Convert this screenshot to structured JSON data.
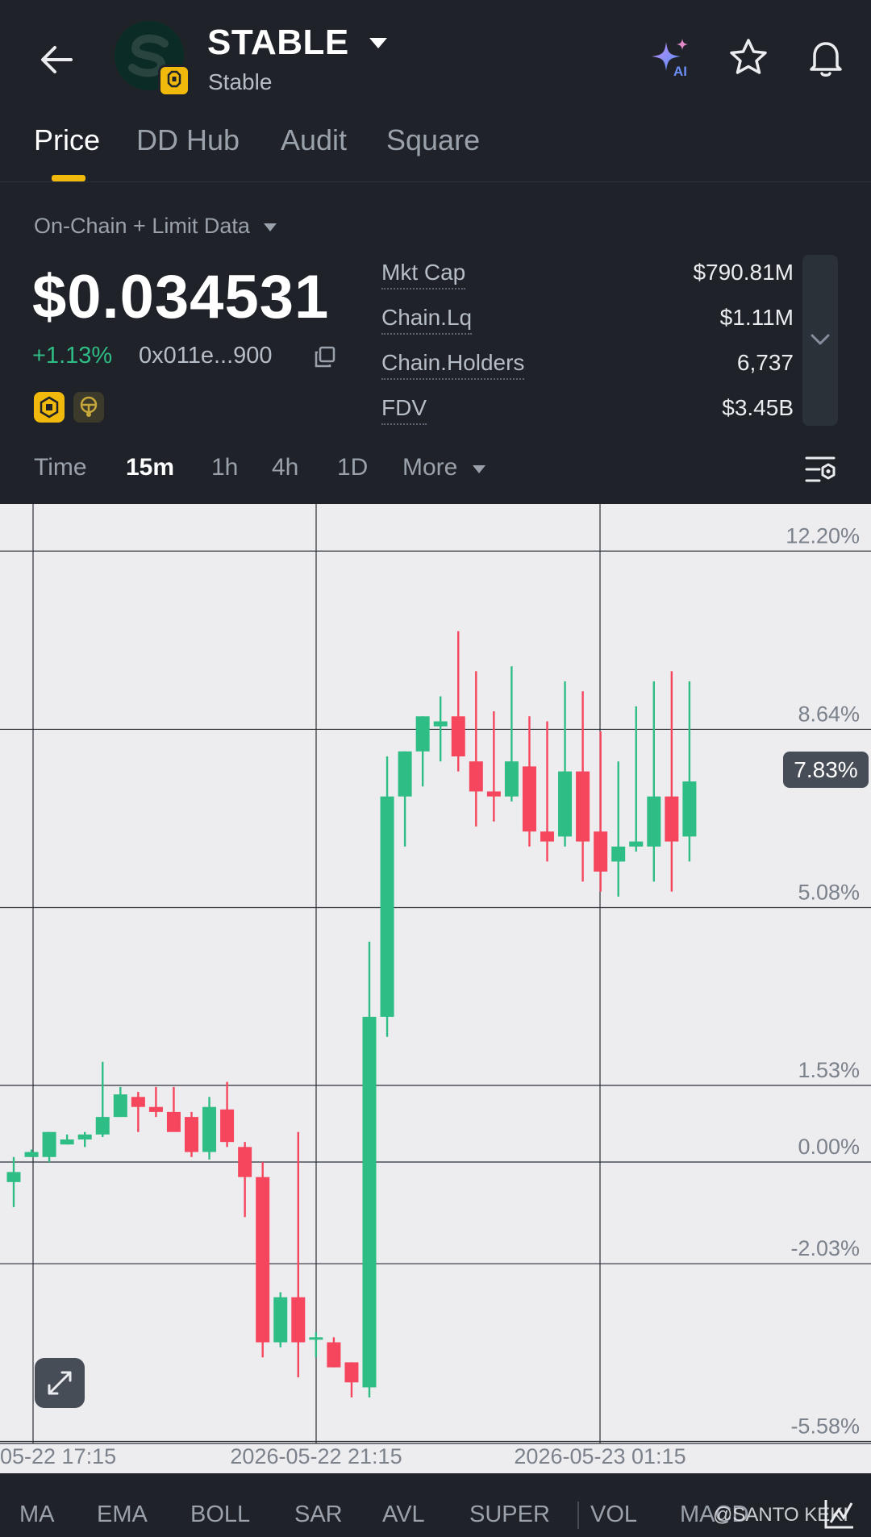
{
  "header": {
    "title": "STABLE",
    "subtitle": "Stable",
    "tabs": [
      {
        "label": "Price",
        "active": true
      },
      {
        "label": "DD Hub",
        "active": false
      },
      {
        "label": "Audit",
        "active": false
      },
      {
        "label": "Square",
        "active": false
      }
    ],
    "icons": [
      "back-arrow-icon",
      "ai-sparkle-icon",
      "star-icon",
      "bell-icon"
    ]
  },
  "info": {
    "data_source": "On-Chain + Limit Data",
    "price": "$0.034531",
    "change": "+1.13%",
    "address": "0x011e...900",
    "stats": [
      {
        "label": "Mkt Cap",
        "value": "$790.81M"
      },
      {
        "label": "Chain.Lq",
        "value": "$1.11M"
      },
      {
        "label": "Chain.Holders",
        "value": "6,737"
      },
      {
        "label": "FDV",
        "value": "$3.45B"
      }
    ]
  },
  "timeframes": [
    {
      "label": "Time",
      "active": false
    },
    {
      "label": "15m",
      "active": true
    },
    {
      "label": "1h",
      "active": false
    },
    {
      "label": "4h",
      "active": false
    },
    {
      "label": "1D",
      "active": false
    },
    {
      "label": "More",
      "active": false
    }
  ],
  "chart_data": {
    "type": "candlestick",
    "y_unit": "%",
    "y_ticks": [
      "12.20%",
      "8.64%",
      "5.08%",
      "1.53%",
      "0.00%",
      "-2.03%",
      "-5.58%"
    ],
    "x_ticks": [
      "05-22 17:15",
      "2026-05-22 21:15",
      "2026-05-23 01:15"
    ],
    "current_value_label": "7.83%",
    "colors": {
      "up": "#2ebd85",
      "down": "#f6465d"
    },
    "candles": [
      {
        "o": -0.4,
        "c": -0.2,
        "h": 0.1,
        "l": -0.9
      },
      {
        "o": 0.1,
        "c": 0.2,
        "h": 0.25,
        "l": 0.1
      },
      {
        "o": 0.1,
        "c": 0.6,
        "h": 0.6,
        "l": 0.0
      },
      {
        "o": 0.35,
        "c": 0.45,
        "h": 0.55,
        "l": 0.35
      },
      {
        "o": 0.45,
        "c": 0.55,
        "h": 0.6,
        "l": 0.3
      },
      {
        "o": 0.55,
        "c": 0.9,
        "h": 2.0,
        "l": 0.5
      },
      {
        "o": 0.9,
        "c": 1.35,
        "h": 1.5,
        "l": 0.9
      },
      {
        "o": 1.3,
        "c": 1.1,
        "h": 1.4,
        "l": 0.6
      },
      {
        "o": 1.1,
        "c": 1.0,
        "h": 1.5,
        "l": 0.9
      },
      {
        "o": 1.0,
        "c": 0.6,
        "h": 1.5,
        "l": 0.7
      },
      {
        "o": 0.9,
        "c": 0.2,
        "h": 1.0,
        "l": 0.1
      },
      {
        "o": 0.2,
        "c": 1.1,
        "h": 1.3,
        "l": 0.05
      },
      {
        "o": 1.05,
        "c": 0.4,
        "h": 1.6,
        "l": 0.3
      },
      {
        "o": 0.3,
        "c": -0.3,
        "h": 0.4,
        "l": -1.1
      },
      {
        "o": -0.3,
        "c": -3.6,
        "h": 0.0,
        "l": -3.9
      },
      {
        "o": -3.6,
        "c": -2.7,
        "h": -2.6,
        "l": -3.7
      },
      {
        "o": -2.7,
        "c": -3.6,
        "h": 0.6,
        "l": -4.3
      },
      {
        "o": -3.5,
        "c": -3.5,
        "h": -3.4,
        "l": -3.9
      },
      {
        "o": -3.6,
        "c": -4.1,
        "h": -3.5,
        "l": -4.1
      },
      {
        "o": -4.0,
        "c": -4.4,
        "h": -4.0,
        "l": -4.7
      },
      {
        "o": -4.5,
        "c": 2.9,
        "h": 4.4,
        "l": -4.7
      },
      {
        "o": 2.9,
        "c": 7.3,
        "h": 8.1,
        "l": 2.5
      },
      {
        "o": 7.3,
        "c": 8.2,
        "h": 8.2,
        "l": 6.3
      },
      {
        "o": 8.2,
        "c": 8.9,
        "h": 8.9,
        "l": 7.5
      },
      {
        "o": 8.7,
        "c": 8.8,
        "h": 9.3,
        "l": 8.0
      },
      {
        "o": 8.9,
        "c": 8.1,
        "h": 10.6,
        "l": 7.8
      },
      {
        "o": 8.0,
        "c": 7.4,
        "h": 9.8,
        "l": 6.7
      },
      {
        "o": 7.4,
        "c": 7.3,
        "h": 9.0,
        "l": 6.8
      },
      {
        "o": 7.3,
        "c": 8.0,
        "h": 9.9,
        "l": 7.2
      },
      {
        "o": 7.9,
        "c": 6.6,
        "h": 8.9,
        "l": 6.3
      },
      {
        "o": 6.6,
        "c": 6.4,
        "h": 8.8,
        "l": 6.0
      },
      {
        "o": 6.5,
        "c": 7.8,
        "h": 9.6,
        "l": 6.3
      },
      {
        "o": 7.8,
        "c": 6.4,
        "h": 9.4,
        "l": 5.6
      },
      {
        "o": 6.6,
        "c": 5.8,
        "h": 8.6,
        "l": 5.4
      },
      {
        "o": 6.0,
        "c": 6.3,
        "h": 8.0,
        "l": 5.3
      },
      {
        "o": 6.3,
        "c": 6.4,
        "h": 9.1,
        "l": 6.2
      },
      {
        "o": 6.3,
        "c": 7.3,
        "h": 9.6,
        "l": 5.6
      },
      {
        "o": 7.3,
        "c": 6.4,
        "h": 9.8,
        "l": 5.4
      },
      {
        "o": 6.5,
        "c": 7.6,
        "h": 9.6,
        "l": 6.0
      }
    ]
  },
  "indicators": [
    "MA",
    "EMA",
    "BOLL",
    "SAR",
    "AVL",
    "SUPER",
    "VOL",
    "MACD"
  ],
  "watermark": "@SANTO KEKI"
}
